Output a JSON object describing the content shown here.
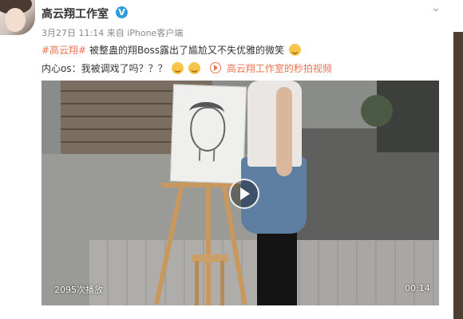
{
  "post": {
    "username": "高云翔工作室",
    "verified_badge": "V",
    "timestamp": "3月27日 11:14",
    "source": "来自 iPhone客户端",
    "hashtag": "#高云翔#",
    "text_line1": "被整蛊的翔Boss露出了尴尬又不失优雅的微笑",
    "text_line2": "内心os：我被调戏了吗？？？",
    "video_link": "高云翔工作室的秒拍视频"
  },
  "video": {
    "play_count": "2095次播放",
    "duration": "00:14"
  },
  "icons": {
    "menu": "chevron-down-icon",
    "verified": "verified-icon",
    "play": "play-icon"
  },
  "colors": {
    "accent": "#eb7350",
    "verified": "#2f9bd8"
  }
}
